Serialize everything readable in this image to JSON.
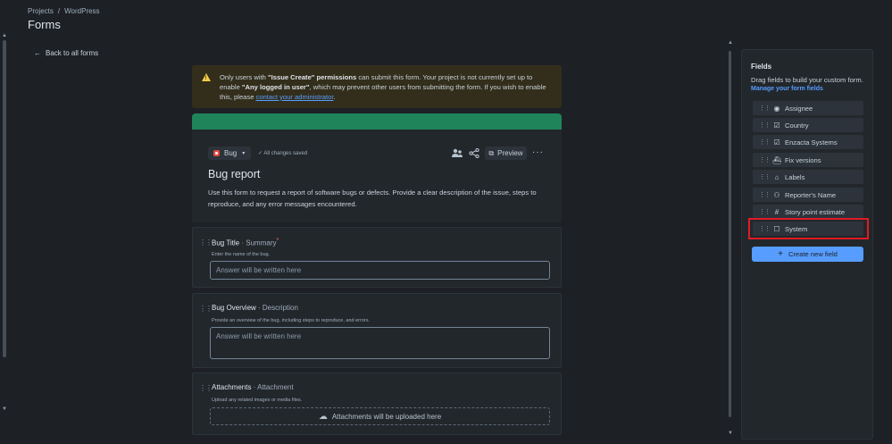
{
  "breadcrumb": {
    "project": "Projects",
    "separator": "/",
    "current": "WordPress"
  },
  "page_title": "Forms",
  "back_link": "Back to all forms",
  "warning": {
    "t1": "Only users with ",
    "b1": "\"Issue Create\" permissions",
    "t2": " can submit this form. Your project is not currently set up to enable ",
    "b2": "\"Any logged in user\"",
    "t3": ", which may prevent other users from submitting the form. If you wish to enable this, please ",
    "link": "contact your administrator",
    "t4": "."
  },
  "form_header": {
    "issue_type": "Bug",
    "saved_status": "All changes saved",
    "preview_label": "Preview",
    "more_label": "···",
    "title": "Bug report",
    "description": "Use this form to request a report of software bugs or defects. Provide a clear description of the issue, steps to reproduce, and any error messages encountered."
  },
  "form_fields": [
    {
      "label": "Bug Title",
      "type": "Summary",
      "required": "*",
      "help": "Enter the name of the bug.",
      "placeholder": "Answer will be written here"
    },
    {
      "label": "Bug Overview",
      "type": "Description",
      "help": "Provide an overview of the bug, including steps to reproduce, and errors.",
      "placeholder": "Answer will be written here"
    },
    {
      "label": "Attachments",
      "type": "Attachment",
      "help": "Upload any related images or media files.",
      "upload_text": "Attachments will be uploaded here"
    }
  ],
  "type_separator": " · ",
  "fields_panel": {
    "title": "Fields",
    "subtitle": "Drag fields to build your custom form.",
    "manage_link": "Manage your form fields",
    "items": [
      {
        "label": "Assignee",
        "icon": "person-circle-icon"
      },
      {
        "label": "Country",
        "icon": "checkbox-icon"
      },
      {
        "label": "Enzacta Systems",
        "icon": "checkbox-icon"
      },
      {
        "label": "Fix versions",
        "icon": "ship-icon"
      },
      {
        "label": "Labels",
        "icon": "tag-icon"
      },
      {
        "label": "Reporter's Name",
        "icon": "people-icon"
      },
      {
        "label": "Story point estimate",
        "icon": "hash-icon"
      },
      {
        "label": "System",
        "icon": "empty-checkbox-icon"
      }
    ],
    "create_button": "Create new field"
  },
  "colors": {
    "accent": "#579dff",
    "warning_bg": "#332e1b",
    "header_bar": "#1f845a",
    "highlight": "#e01b24"
  }
}
